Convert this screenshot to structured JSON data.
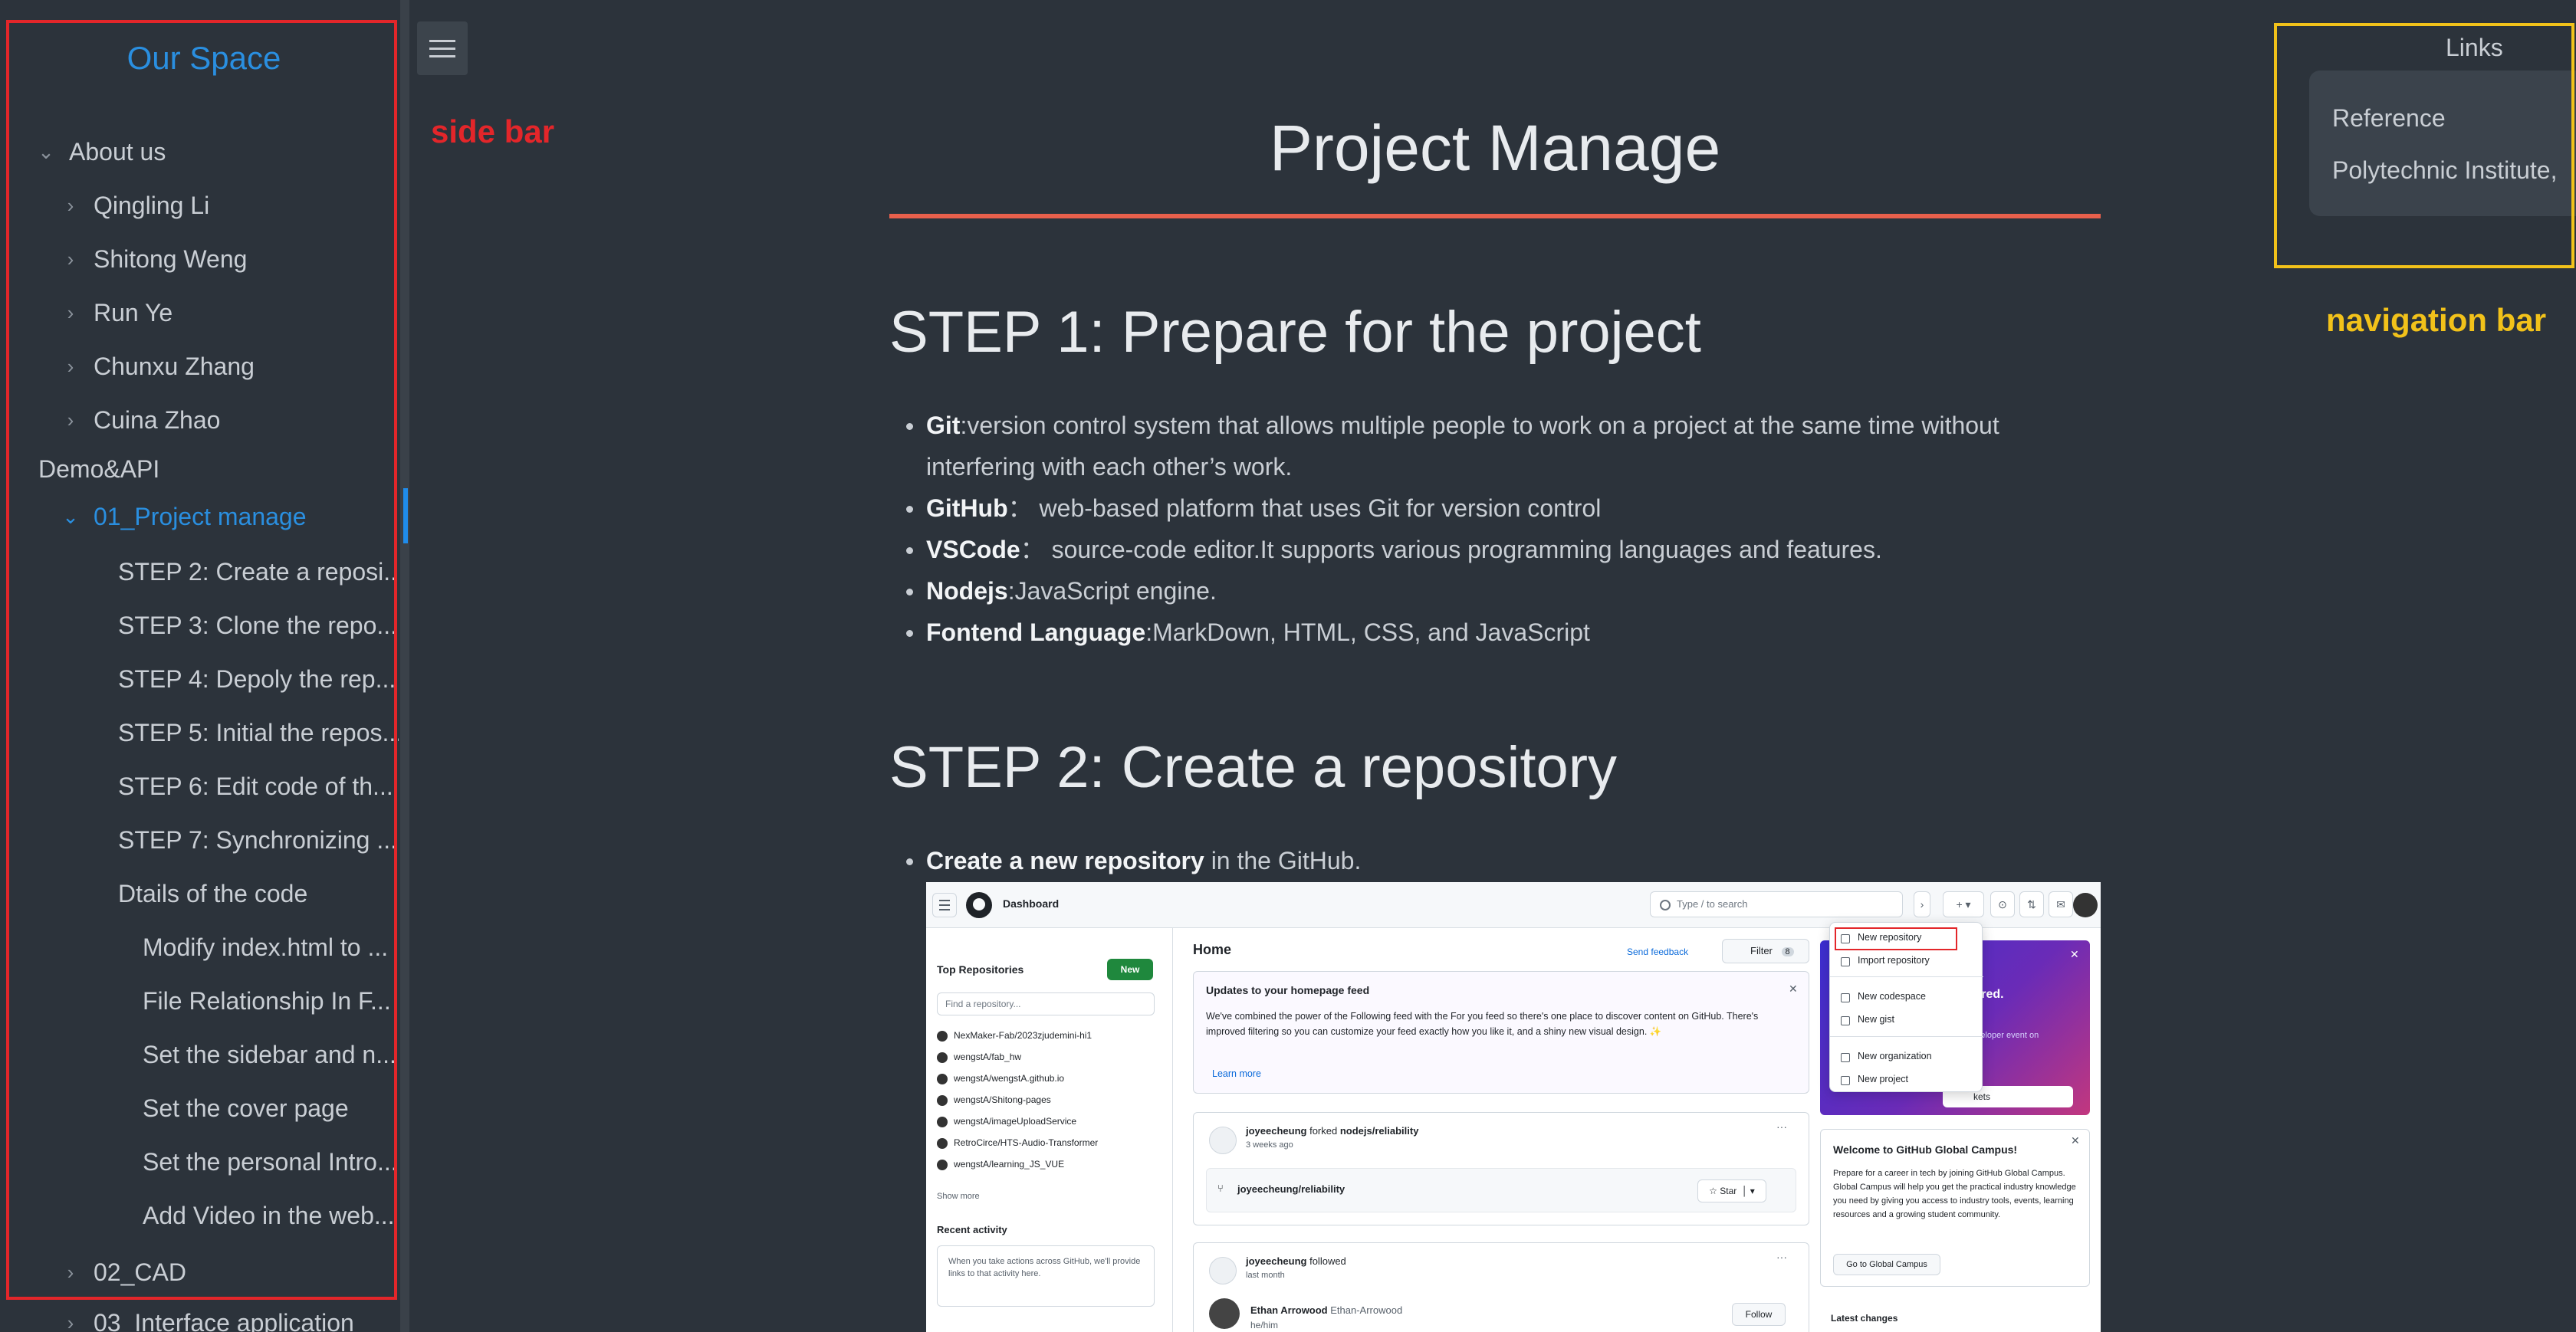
{
  "sidebar": {
    "title": "Our Space",
    "items": [
      {
        "label": "About us",
        "chevron": "down"
      },
      {
        "label": "Qingling Li",
        "chevron": "right"
      },
      {
        "label": "Shitong Weng",
        "chevron": "right"
      },
      {
        "label": "Run Ye",
        "chevron": "right"
      },
      {
        "label": "Chunxu Zhang",
        "chevron": "right"
      },
      {
        "label": "Cuina Zhao",
        "chevron": "right"
      },
      {
        "label": "Demo&API",
        "chevron": "none"
      },
      {
        "label": "01_Project manage",
        "chevron": "down",
        "active": true
      },
      {
        "label": "STEP 2: Create a reposi...",
        "chevron": "none"
      },
      {
        "label": "STEP 3: Clone the repo...",
        "chevron": "none"
      },
      {
        "label": "STEP 4: Depoly the rep...",
        "chevron": "none"
      },
      {
        "label": "STEP 5: Initial the repos...",
        "chevron": "none"
      },
      {
        "label": "STEP 6: Edit code of th...",
        "chevron": "none"
      },
      {
        "label": "STEP 7: Synchronizing ...",
        "chevron": "none"
      },
      {
        "label": "Dtails of the code",
        "chevron": "none"
      },
      {
        "label": "Modify index.html to ...",
        "chevron": "none"
      },
      {
        "label": "File Relationship In F...",
        "chevron": "none"
      },
      {
        "label": "Set the sidebar and n...",
        "chevron": "none"
      },
      {
        "label": "Set the cover page",
        "chevron": "none"
      },
      {
        "label": "Set the personal Intro...",
        "chevron": "none"
      },
      {
        "label": "Add Video in the web...",
        "chevron": "none"
      },
      {
        "label": "02_CAD",
        "chevron": "right"
      },
      {
        "label": "03_Interface application",
        "chevron": "right"
      }
    ]
  },
  "annotations": {
    "sidebar_label": "side bar",
    "navbar_label": "navigation bar",
    "sidebar_color": "#e3262a",
    "navbar_color": "#f2c21a"
  },
  "main": {
    "title": "Project Manage",
    "step1": {
      "heading": "STEP 1: Prepare for the project",
      "bullets": [
        {
          "term": "Git",
          "text": ":version control system that allows multiple people to work on a project at the same time without interfering with each other’s work."
        },
        {
          "term": "GitHub",
          "text": "： web-based platform that uses Git for version control"
        },
        {
          "term": "VSCode",
          "text": "： source-code editor.It supports various programming languages and features."
        },
        {
          "term": "Nodejs",
          "text": ":JavaScript engine."
        },
        {
          "term": "Fontend Language",
          "text": ":MarkDown, HTML, CSS, and JavaScript"
        }
      ]
    },
    "step2": {
      "heading": "STEP 2: Create a repository",
      "bullets": [
        {
          "term": "Create a new repository",
          "text": " in the GitHub."
        }
      ]
    }
  },
  "github_screenshot": {
    "dashboard": "Dashboard",
    "search_placeholder": "Type / to search",
    "top_repos": "Top Repositories",
    "new_btn": "New",
    "find_placeholder": "Find a repository...",
    "repos": [
      "NexMaker-Fab/2023zjudemini-hi1",
      "wengstA/fab_hw",
      "wengstA/wengstA.github.io",
      "wengstA/Shitong-pages",
      "wengstA/imageUploadService",
      "RetroCirce/HTS-Audio-Transformer",
      "wengstA/learning_JS_VUE"
    ],
    "show_more": "Show more",
    "recent_activity": "Recent activity",
    "recent_text": "When you take actions across GitHub, we'll provide links to that activity here.",
    "home": "Home",
    "send_feedback": "Send feedback",
    "filter": "Filter",
    "filter_count": "8",
    "update_title": "Updates to your homepage feed",
    "update_body": "We've combined the power of the Following feed with the For you feed so there's one place to discover content on GitHub. There's improved filtering so you can customize your feed exactly how you like it, and a shiny new visual design. ✨",
    "learn_more": "Learn more",
    "feed1_user": "joyeecheung",
    "feed1_action": "forked",
    "feed1_repo": "nodejs/reliability",
    "feed1_time": "3 weeks ago",
    "feed1_fork": "joyeecheung/reliability",
    "star": "Star",
    "feed2_user": "joyeecheung",
    "feed2_action": "followed",
    "feed2_time": "last month",
    "feed2_person": "Ethan Arrowood",
    "feed2_handle": "Ethan-Arrowood",
    "feed2_sub": "he/him",
    "follow": "Follow",
    "promo_title": "swered.",
    "promo_sub": "al developer event on",
    "promo_btn": "kets",
    "campus_title": "Welcome to GitHub Global Campus!",
    "campus_body": "Prepare for a career in tech by joining GitHub Global Campus. Global Campus will help you get the practical industry knowledge you need by giving you access to industry tools, events, learning resources and a growing student community.",
    "campus_btn": "Go to Global Campus",
    "latest_changes": "Latest changes",
    "menu": {
      "items": [
        "New repository",
        "Import repository",
        "New codespace",
        "New gist",
        "New organization",
        "New project"
      ]
    }
  },
  "links_nav": {
    "title": "Links",
    "items": [
      "Reference",
      "Polytechnic Institute,"
    ]
  }
}
